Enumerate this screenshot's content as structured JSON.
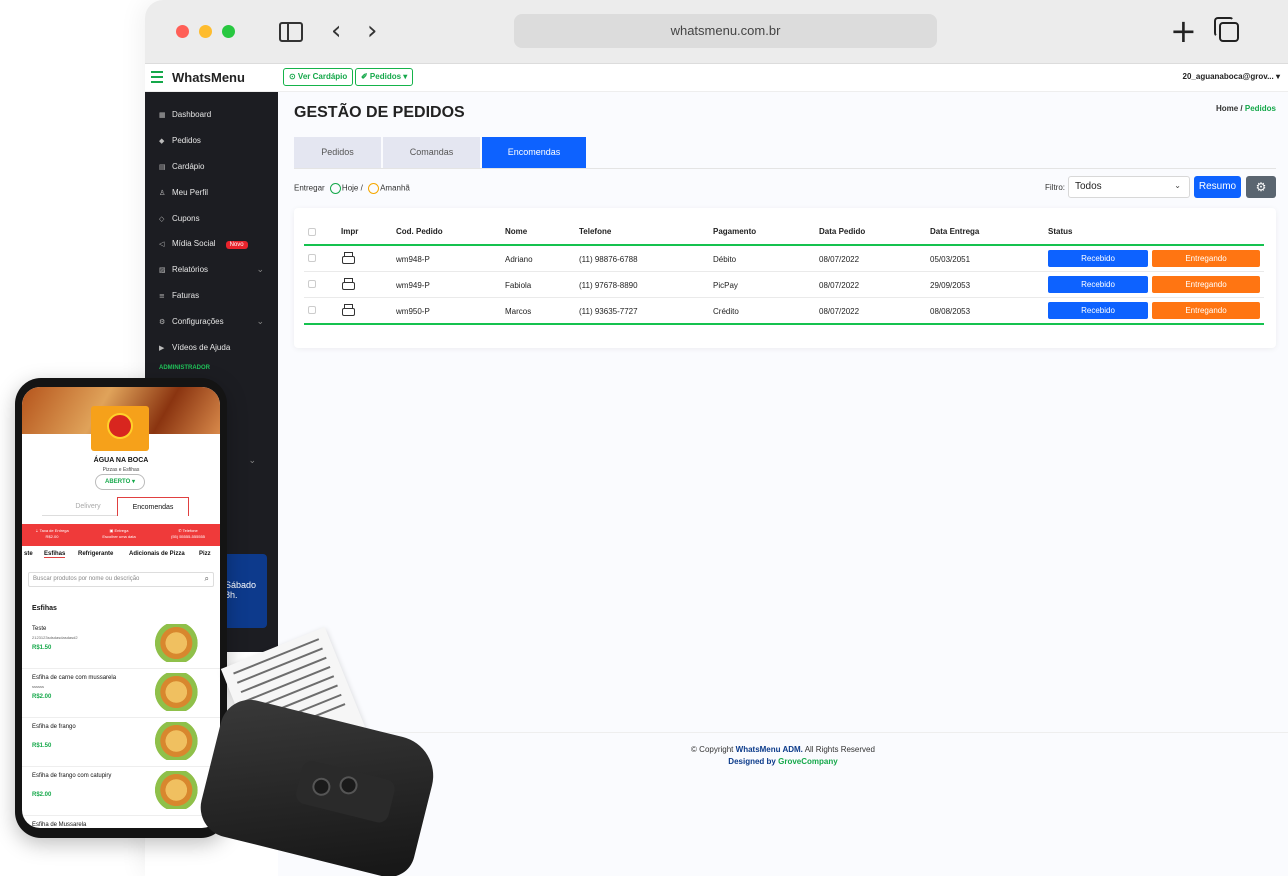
{
  "browser": {
    "url": "whatsmenu.com.br"
  },
  "app": {
    "brand": "WhatsMenu",
    "buttons": {
      "ver_cardapio": "⊙ Ver Cardápio",
      "pedidos": "✐ Pedidos ▾"
    },
    "user": "20_aguanaboca@grov... ▾"
  },
  "sidebar": {
    "items": [
      {
        "icon": "dashboard-icon",
        "label": "Dashboard"
      },
      {
        "icon": "tag-icon",
        "label": "Pedidos"
      },
      {
        "icon": "menu-book-icon",
        "label": "Cardápio"
      },
      {
        "icon": "user-icon",
        "label": "Meu Perfil"
      },
      {
        "icon": "coupon-icon",
        "label": "Cupons"
      },
      {
        "icon": "megaphone-icon",
        "label": "Mídia Social",
        "badge": "Novo"
      },
      {
        "icon": "chart-icon",
        "label": "Relatórios"
      },
      {
        "icon": "list-icon",
        "label": "Faturas"
      },
      {
        "icon": "gear-icon",
        "label": "Configurações"
      },
      {
        "icon": "video-icon",
        "label": "Vídeos de Ajuda"
      }
    ],
    "section": "ADMINISTRADOR",
    "promo_line1": "Sábado",
    "promo_line2": "8h."
  },
  "main": {
    "title": "GESTÃO DE PEDIDOS",
    "breadcrumb": {
      "home": "Home",
      "sep": "/",
      "current": "Pedidos"
    },
    "tabs": [
      "Pedidos",
      "Comandas",
      "Encomendas"
    ],
    "active_tab": "Encomendas",
    "deliver": {
      "label": "Entregar",
      "today": "Hoje /",
      "tomorrow": "Amanhã"
    },
    "filter": {
      "label": "Filtro:",
      "value": "Todos"
    },
    "resumo": "Resumo",
    "table": {
      "headers": [
        "Impr",
        "Cod. Pedido",
        "Nome",
        "Telefone",
        "Pagamento",
        "Data Pedido",
        "Data Entrega",
        "Status"
      ],
      "rows": [
        {
          "code": "wm948-P",
          "name": "Adriano",
          "phone": "(11) 98876-6788",
          "payment": "Débito",
          "date": "08/07/2022",
          "delivery": "05/03/2051",
          "status_a": "Recebido",
          "status_b": "Entregando"
        },
        {
          "code": "wm949-P",
          "name": "Fabiola",
          "phone": "(11) 97678-8890",
          "payment": "PicPay",
          "date": "08/07/2022",
          "delivery": "29/09/2053",
          "status_a": "Recebido",
          "status_b": "Entregando"
        },
        {
          "code": "wm950-P",
          "name": "Marcos",
          "phone": "(11) 93635-7727",
          "payment": "Crédito",
          "date": "08/07/2022",
          "delivery": "08/08/2053",
          "status_a": "Recebido",
          "status_b": "Entregando"
        }
      ]
    },
    "footer": {
      "copy": "© Copyright",
      "brand": "WhatsMenu ADM.",
      "rights": "All Rights Reserved",
      "designed": "Designed by",
      "company": "GroveCompany"
    }
  },
  "phone": {
    "store": "ÁGUA NA BOCA",
    "subtitle": "Pizzas e Esfihas",
    "status": "ABERTO ▾",
    "tabs": [
      "Delivery",
      "Encomendas"
    ],
    "info": {
      "fee_label": "⇣ Taxa de Entrega",
      "fee_value": "R$2.00",
      "delivery_label": "▣ Entrega",
      "delivery_value": "Escolher uma data",
      "phone_label": "✆ Telefone",
      "phone_value": "(55) 55555-555555"
    },
    "categories": [
      "ste",
      "Esfihas",
      "Refrigerante",
      "Adicionais de Pizza",
      "Pizz"
    ],
    "search_placeholder": "Buscar produtos por nome ou descrição",
    "section": "Esfihas",
    "products": [
      {
        "name": "Teste",
        "desc": "2123123sdsdasdasdasd2",
        "price": "R$1.50"
      },
      {
        "name": "Esfiha de carne com mussarela",
        "desc": "ssssss",
        "price": "R$2.00"
      },
      {
        "name": "Esfiha de frango",
        "desc": "",
        "price": "R$1.50"
      },
      {
        "name": "Esfiha de frango com catupiry",
        "desc": "",
        "price": "R$2.00"
      },
      {
        "name": "Esfiha de Mussarela",
        "desc": "",
        "price": ""
      }
    ]
  }
}
